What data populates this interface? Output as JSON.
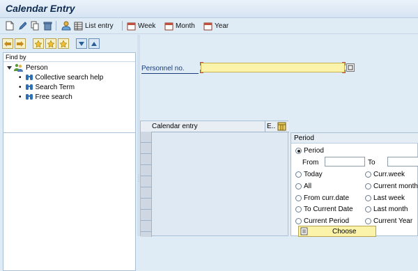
{
  "title": "Calendar Entry",
  "toolbar": {
    "list_entry": "List entry",
    "week": "Week",
    "month": "Month",
    "year": "Year"
  },
  "tree": {
    "header": "Find by",
    "root": "Person",
    "items": [
      "Collective search help",
      "Search Term",
      "Free search"
    ]
  },
  "form": {
    "personnel_label": "Personnel no.",
    "personnel_value": ""
  },
  "grid": {
    "column": "Calendar entry",
    "column_short": "E.."
  },
  "period": {
    "title": "Period",
    "period_option": "Period",
    "from_label": "From",
    "to_label": "To",
    "options_left": [
      "Today",
      "All",
      "From curr.date",
      "To Current Date",
      "Current Period"
    ],
    "options_right": [
      "Curr.week",
      "Current month",
      "Last week",
      "Last month",
      "Current Year"
    ],
    "choose_label": "Choose",
    "selected": "Period"
  }
}
